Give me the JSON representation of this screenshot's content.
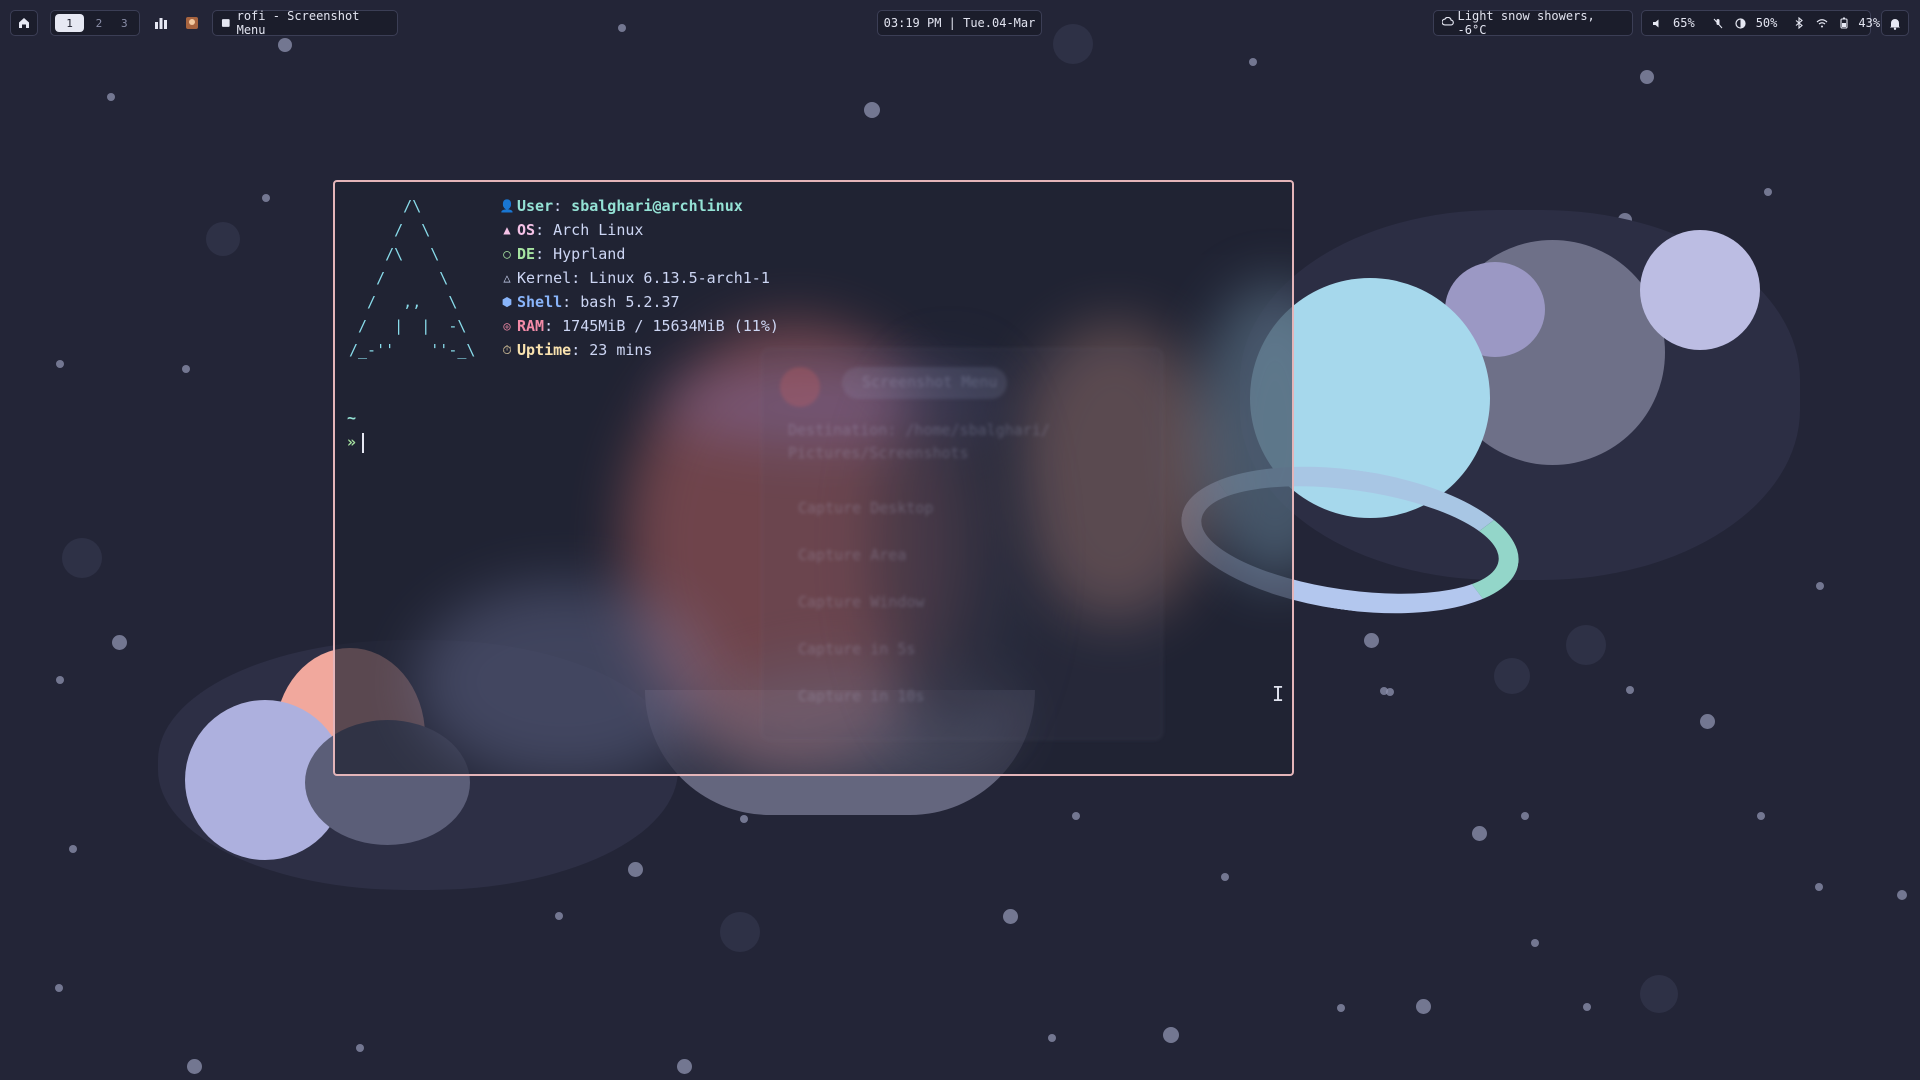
{
  "topbar": {
    "home_icon": "home-icon",
    "workspaces": [
      "1",
      "2",
      "3"
    ],
    "active_workspace": "1",
    "window_title": "rofi - Screenshot Menu",
    "clock": "03:19 PM | Tue.04-Mar",
    "weather": "Light snow showers, -6°C",
    "volume": "65%",
    "brightness": "50%",
    "battery": "43%"
  },
  "terminal": {
    "logo": "      /\\\n     /  \\\n    /\\   \\\n   /      \\\n  /   ,,   \\\n /   |  |  -\\\n/_-''    ''-_\\",
    "info": [
      {
        "key": "User",
        "value": " sbalghari@archlinux",
        "color": "#94e2d5",
        "icon": "user-icon"
      },
      {
        "key": "OS",
        "value": " Arch Linux",
        "color": "#f5c2e7",
        "icon": "arch-icon"
      },
      {
        "key": "DE",
        "value": " Hyprland",
        "color": "#a6e3a1",
        "icon": "drop-icon"
      },
      {
        "key": "Kernel",
        "value": " Linux 6.13.5-arch1-1",
        "color": "#cdd6f4",
        "icon": "tux-icon"
      },
      {
        "key": "Shell",
        "value": " bash 5.2.37",
        "color": "#89b4fa",
        "icon": "shell-icon"
      },
      {
        "key": "RAM",
        "value": " 1745MiB / 15634MiB (11%)",
        "color": "#f38ba8",
        "icon": "ram-icon"
      },
      {
        "key": "Uptime",
        "value": " 23 mins",
        "color": "#f9e2af",
        "icon": "timer-icon"
      }
    ],
    "cwd": "~",
    "prompt_symbol": "»"
  },
  "ghost_menu": {
    "title": "Screenshot Menu",
    "destination": "Destination: /home/sbalghari/",
    "destination2": "Pictures/Screenshots",
    "items": [
      "Capture Desktop",
      "Capture Area",
      "Capture Window",
      "Capture in 5s",
      "Capture in 10s"
    ]
  },
  "colors": {
    "background": "#232537",
    "terminal_border": "#e4b5b9",
    "logo": "#89dceb",
    "prompt": "#a6e3a1"
  }
}
